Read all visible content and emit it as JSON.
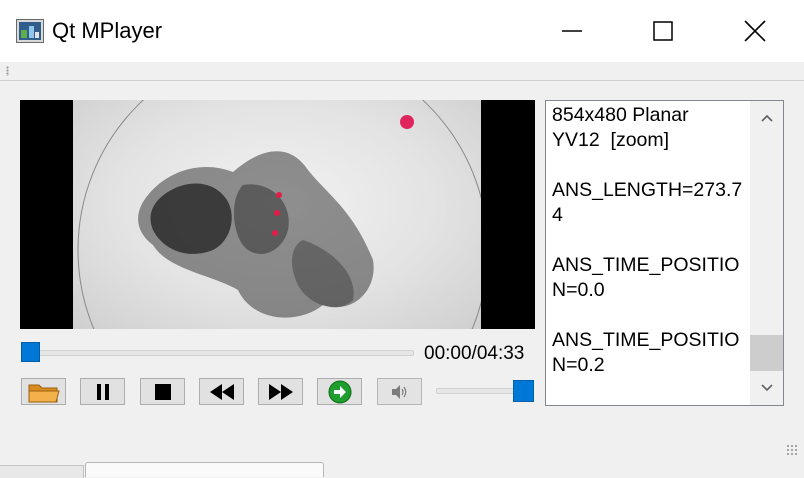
{
  "window": {
    "title": "Qt MPlayer",
    "icons": {
      "app": "media-player-app-icon",
      "minimize": "minimize-icon",
      "maximize": "maximize-icon",
      "close": "close-icon"
    }
  },
  "player": {
    "time_display": "00:00/04:33",
    "seek_progress": 0.0,
    "volume_level": 1.0,
    "video_watermark": "",
    "controls": [
      {
        "name": "open-button",
        "icon": "folder-icon"
      },
      {
        "name": "pause-button",
        "icon": "pause-icon"
      },
      {
        "name": "stop-button",
        "icon": "stop-icon"
      },
      {
        "name": "rewind-button",
        "icon": "rewind-icon"
      },
      {
        "name": "forward-button",
        "icon": "fast-forward-icon"
      },
      {
        "name": "go-button",
        "icon": "green-arrow-icon"
      },
      {
        "name": "volume-button",
        "icon": "speaker-icon"
      }
    ]
  },
  "log": {
    "text": "854x480 Planar\nYV12  [zoom]\n\nANS_LENGTH=273.7\n4\n\nANS_TIME_POSITIO\nN=0.0\n\nANS_TIME_POSITIO\nN=0.2"
  },
  "colors": {
    "accent": "#0078d7",
    "go_green": "#1f9d2f",
    "folder_orange": "#e7a23a"
  }
}
